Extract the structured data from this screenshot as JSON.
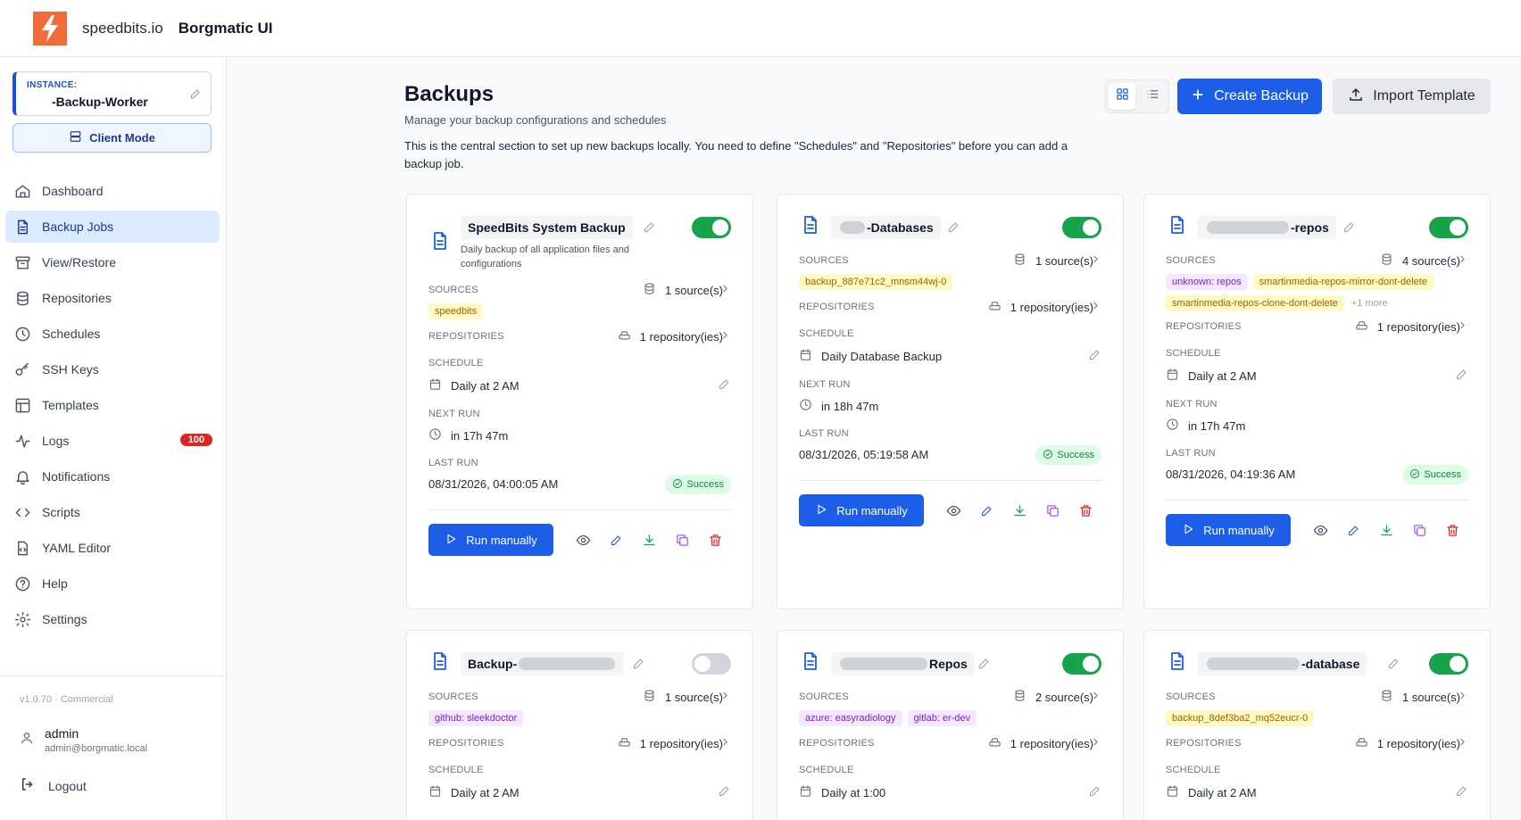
{
  "header": {
    "brand": "speedbits.io",
    "app_name": "Borgmatic UI"
  },
  "instance": {
    "label": "INSTANCE:",
    "value": "-Backup-Worker"
  },
  "client_mode": "Client Mode",
  "nav": [
    {
      "label": "Dashboard",
      "icon": "home-icon"
    },
    {
      "label": "Backup Jobs",
      "icon": "document-icon",
      "active": true
    },
    {
      "label": "View/Restore",
      "icon": "archive-icon"
    },
    {
      "label": "Repositories",
      "icon": "database-icon"
    },
    {
      "label": "Schedules",
      "icon": "clock-icon"
    },
    {
      "label": "SSH Keys",
      "icon": "key-icon"
    },
    {
      "label": "Templates",
      "icon": "layout-icon"
    },
    {
      "label": "Logs",
      "icon": "activity-icon",
      "badge": "100"
    },
    {
      "label": "Notifications",
      "icon": "bell-icon"
    },
    {
      "label": "Scripts",
      "icon": "code-icon"
    },
    {
      "label": "YAML Editor",
      "icon": "file-code-icon"
    },
    {
      "label": "Help",
      "icon": "help-icon"
    },
    {
      "label": "Settings",
      "icon": "gear-icon"
    }
  ],
  "version": "v1.0.70 · Commercial",
  "user": {
    "name": "admin",
    "email": "admin@borgmatic.local"
  },
  "logout": "Logout",
  "page": {
    "title": "Backups",
    "subtitle": "Manage your backup configurations and schedules",
    "description": "This is the central section to set up new backups locally. You need to define \"Schedules\" and \"Repositories\" before you can add a backup job.",
    "create_label": "Create Backup",
    "import_label": "Import Template"
  },
  "labels": {
    "sources": "SOURCES",
    "repositories": "REPOSITORIES",
    "schedule": "SCHEDULE",
    "next_run": "NEXT RUN",
    "last_run": "LAST RUN",
    "run_manually": "Run manually",
    "success": "Success"
  },
  "colors": {
    "primary": "#1d5ee8",
    "toggle_on": "#16a34a",
    "danger": "#dc2626",
    "brand": "#f26b3a"
  },
  "cards": [
    {
      "title": "SpeedBits System Backup",
      "description": "Daily backup of all application files and configurations",
      "enabled": true,
      "sources_count": "1 source(s)",
      "sources": [
        {
          "text": "speedbits",
          "style": "yellow"
        }
      ],
      "repos_count": "1 repository(ies)",
      "schedule": "Daily at 2 AM",
      "next_run": "in 17h 47m",
      "last_run": "08/31/2026, 04:00:05 AM",
      "last_status": "Success"
    },
    {
      "title": "-Databases",
      "enabled": true,
      "sources_count": "1 source(s)",
      "sources": [
        {
          "text": "backup_887e71c2_mnsm44wj-0",
          "style": "yellow"
        }
      ],
      "repos_count": "1 repository(ies)",
      "schedule": "Daily Database Backup",
      "next_run": "in 18h 47m",
      "last_run": "08/31/2026, 05:19:58 AM",
      "last_status": "Success"
    },
    {
      "title": "-repos",
      "enabled": true,
      "sources_count": "4 source(s)",
      "sources": [
        {
          "text": "unknown: repos",
          "style": "purple"
        },
        {
          "text": "smartinmedia-repos-mirror-dont-delete",
          "style": "yellow"
        },
        {
          "text": "smartinmedia-repos-clone-dont-delete",
          "style": "yellow"
        },
        {
          "text": "+1 more",
          "style": "more"
        }
      ],
      "repos_count": "1 repository(ies)",
      "schedule": "Daily at 2 AM",
      "next_run": "in 17h 47m",
      "last_run": "08/31/2026, 04:19:36 AM",
      "last_status": "Success"
    },
    {
      "title": "Backup-",
      "enabled": false,
      "sources_count": "1 source(s)",
      "sources": [
        {
          "text": "github: sleekdoctor",
          "style": "purple"
        }
      ],
      "repos_count": "1 repository(ies)",
      "schedule": "Daily at 2 AM"
    },
    {
      "title": "Repos",
      "enabled": true,
      "sources_count": "2 source(s)",
      "sources": [
        {
          "text": "azure: easyradiology",
          "style": "purple"
        },
        {
          "text": "gitlab: er-dev",
          "style": "purple"
        }
      ],
      "repos_count": "1 repository(ies)",
      "schedule": "Daily at 1:00"
    },
    {
      "title": "-database",
      "enabled": true,
      "sources_count": "1 source(s)",
      "sources": [
        {
          "text": "backup_8def3ba2_mq52eucr-0",
          "style": "yellow"
        }
      ],
      "repos_count": "1 repository(ies)",
      "schedule": "Daily at 2 AM"
    }
  ]
}
